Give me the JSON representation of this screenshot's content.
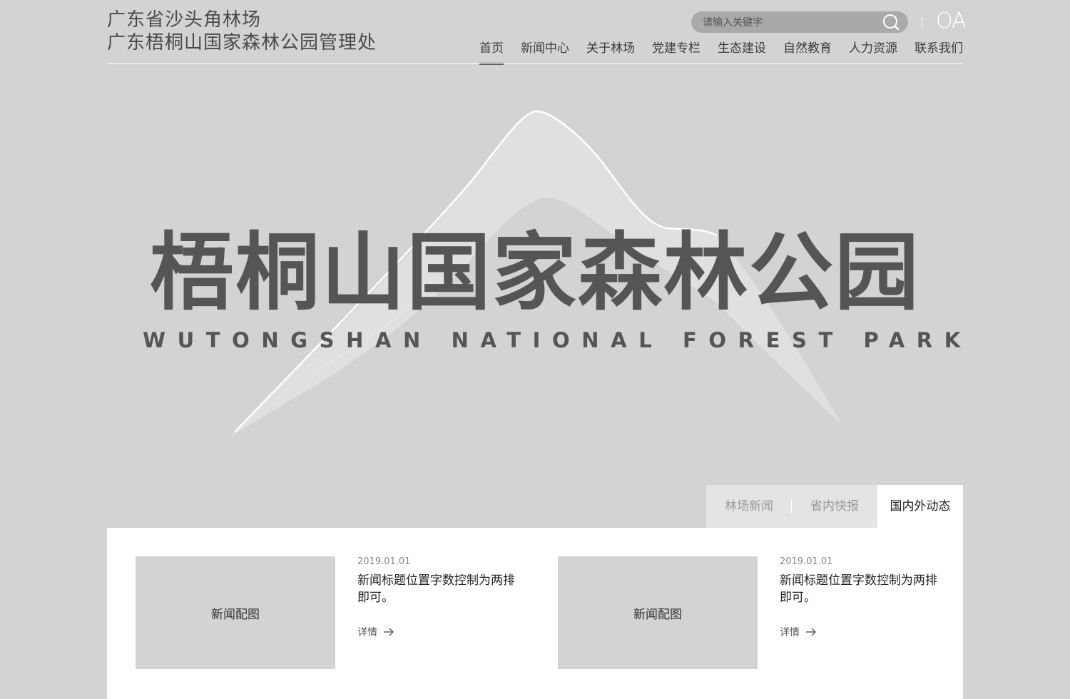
{
  "brand": {
    "line1": "广东省沙头角林场",
    "line2": "广东梧桐山国家森林公园管理处"
  },
  "search": {
    "placeholder": "请输入关键字",
    "icon": "search-icon"
  },
  "oa": {
    "label": "OA"
  },
  "nav": {
    "items": [
      {
        "label": "首页",
        "active": true
      },
      {
        "label": "新闻中心"
      },
      {
        "label": "关于林场"
      },
      {
        "label": "党建专栏"
      },
      {
        "label": "生态建设"
      },
      {
        "label": "自然教育"
      },
      {
        "label": "人力资源"
      },
      {
        "label": "联系我们"
      }
    ]
  },
  "hero": {
    "title": "梧桐山国家森林公园",
    "subtitle": "WUTONGSHAN NATIONAL FOREST PARK"
  },
  "tabs": [
    {
      "label": "林场新闻"
    },
    {
      "label": "省内快报"
    },
    {
      "label": "国内外动态",
      "active": true
    }
  ],
  "news": [
    {
      "image_label": "新闻配图",
      "date": "2019.01.01",
      "title": "新闻标题位置字数控制为两排即可。",
      "more": "详情"
    },
    {
      "image_label": "新闻配图",
      "date": "2019.01.01",
      "title": "新闻标题位置字数控制为两排即可。",
      "more": "详情"
    }
  ],
  "colors": {
    "background": "#d3d3d3",
    "search_bg": "#a9a9a9",
    "hero_text": "#555555",
    "panel": "#ffffff"
  }
}
